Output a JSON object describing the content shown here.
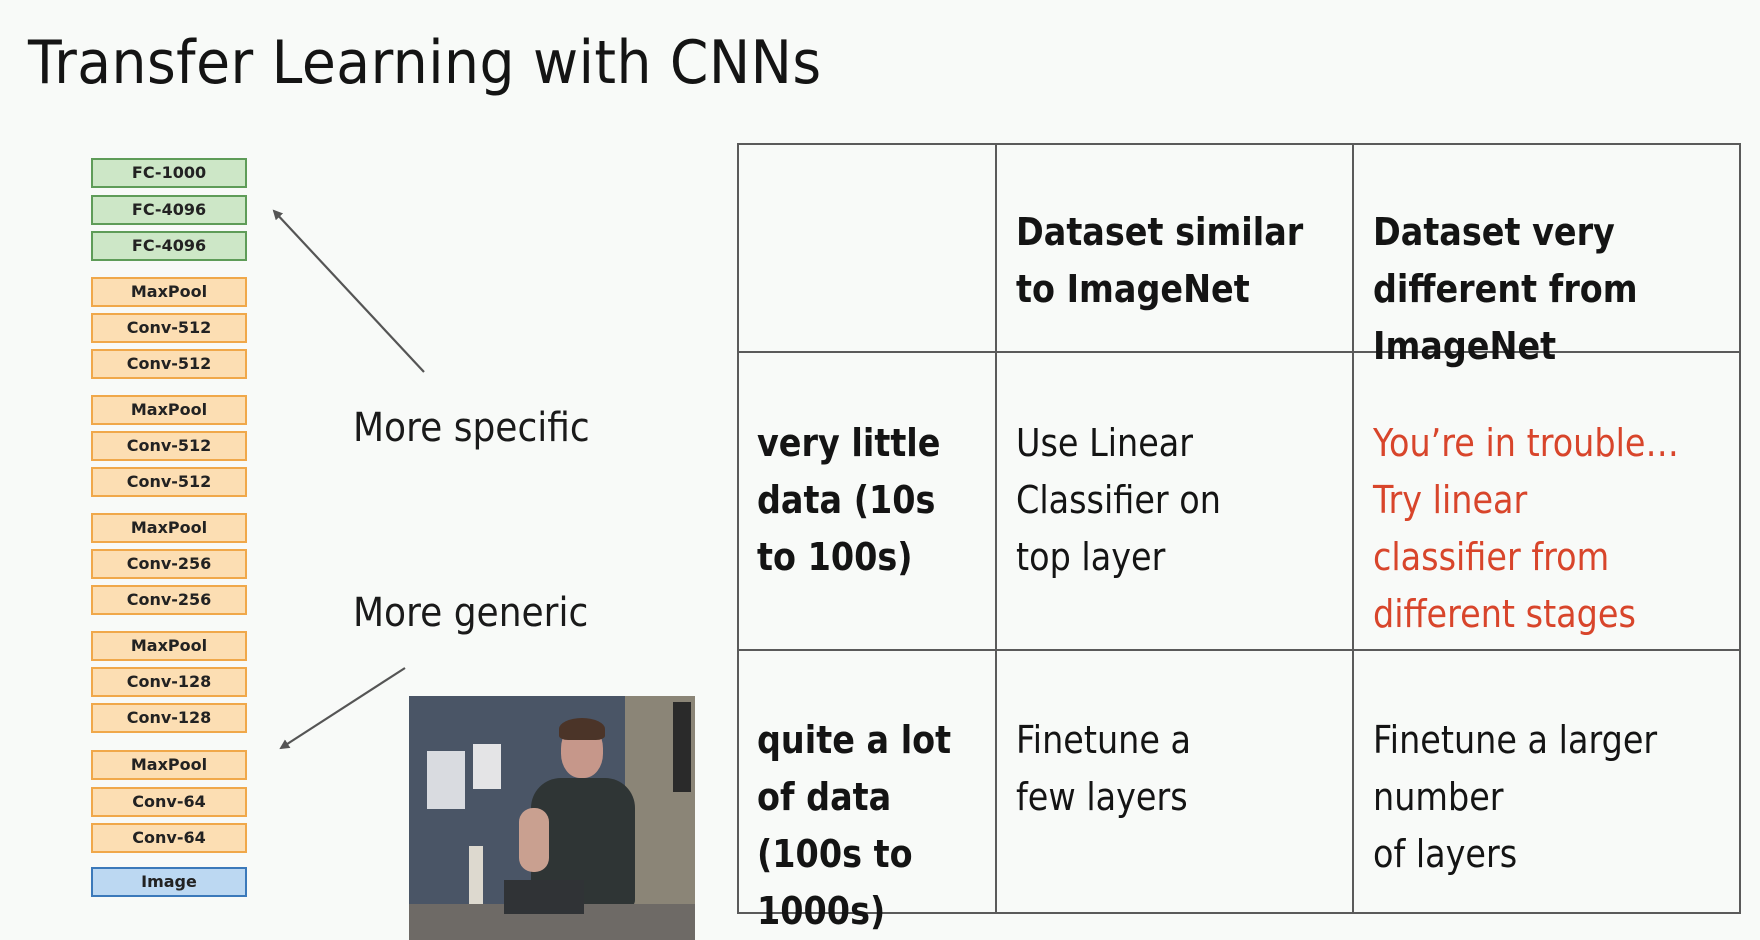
{
  "slide": {
    "title": "Transfer Learning with CNNs"
  },
  "colors": {
    "background": "#f8faf8",
    "fc_fill": "#cde7c7",
    "fc_border": "#5e9c58",
    "conv_fill": "#fcdeb3",
    "conv_border": "#f0a84a",
    "image_fill": "#bcd8f2",
    "image_border": "#3b79ba",
    "warning_text": "#d8452b"
  },
  "network": {
    "layers": [
      {
        "label": "FC-1000",
        "type": "fc"
      },
      {
        "label": "FC-4096",
        "type": "fc"
      },
      {
        "label": "FC-4096",
        "type": "fc"
      },
      {
        "label": "MaxPool",
        "type": "pool"
      },
      {
        "label": "Conv-512",
        "type": "conv"
      },
      {
        "label": "Conv-512",
        "type": "conv"
      },
      {
        "label": "MaxPool",
        "type": "pool"
      },
      {
        "label": "Conv-512",
        "type": "conv"
      },
      {
        "label": "Conv-512",
        "type": "conv"
      },
      {
        "label": "MaxPool",
        "type": "pool"
      },
      {
        "label": "Conv-256",
        "type": "conv"
      },
      {
        "label": "Conv-256",
        "type": "conv"
      },
      {
        "label": "MaxPool",
        "type": "pool"
      },
      {
        "label": "Conv-128",
        "type": "conv"
      },
      {
        "label": "Conv-128",
        "type": "conv"
      },
      {
        "label": "MaxPool",
        "type": "pool"
      },
      {
        "label": "Conv-64",
        "type": "conv"
      },
      {
        "label": "Conv-64",
        "type": "conv"
      },
      {
        "label": "Image",
        "type": "image"
      }
    ]
  },
  "annotations": {
    "more_specific": "More specific",
    "more_generic": "More generic"
  },
  "webcam": {
    "description": "presenter webcam feed"
  },
  "table": {
    "column_headers": [
      "",
      "Dataset similar\nto ImageNet",
      "Dataset very\ndifferent from\nImageNet"
    ],
    "rows": [
      {
        "header": "very little\ndata (10s\nto 100s)",
        "cells": [
          {
            "text": "Use Linear\nClassifier on\ntop layer",
            "emphasis": false
          },
          {
            "text": "You’re in trouble…\nTry linear\nclassifier from\ndifferent stages",
            "emphasis": true
          }
        ]
      },
      {
        "header": "quite a lot\nof data\n(100s to\n1000s)",
        "cells": [
          {
            "text": "Finetune a\nfew layers",
            "emphasis": false
          },
          {
            "text": "Finetune a larger\nnumber\nof layers",
            "emphasis": false
          }
        ]
      }
    ]
  }
}
